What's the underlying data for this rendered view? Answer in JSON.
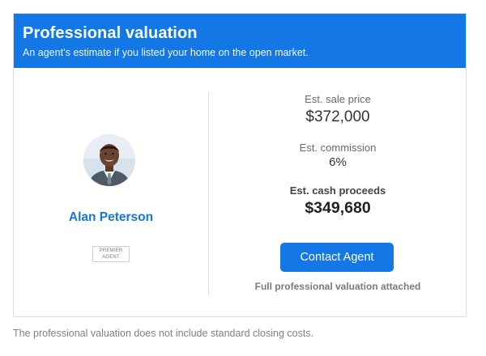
{
  "header": {
    "title": "Professional valuation",
    "subtitle": "An agent’s estimate if you listed your home on the open market."
  },
  "agent": {
    "name": "Alan Peterson",
    "badge_line1": "PREMIER",
    "badge_line2": "AGENT",
    "avatar_icon": "agent-portrait"
  },
  "estimate": {
    "sale_price_label": "Est. sale price",
    "sale_price_value": "$372,000",
    "commission_label": "Est. commission",
    "commission_value": "6%",
    "proceeds_label": "Est. cash proceeds",
    "proceeds_value": "$349,680"
  },
  "actions": {
    "contact_label": "Contact Agent",
    "attached_note": "Full professional valuation attached"
  },
  "footnote": "The professional valuation does not include standard closing costs.",
  "colors": {
    "brand_blue": "#1377e6",
    "agent_name": "#1576d6"
  }
}
